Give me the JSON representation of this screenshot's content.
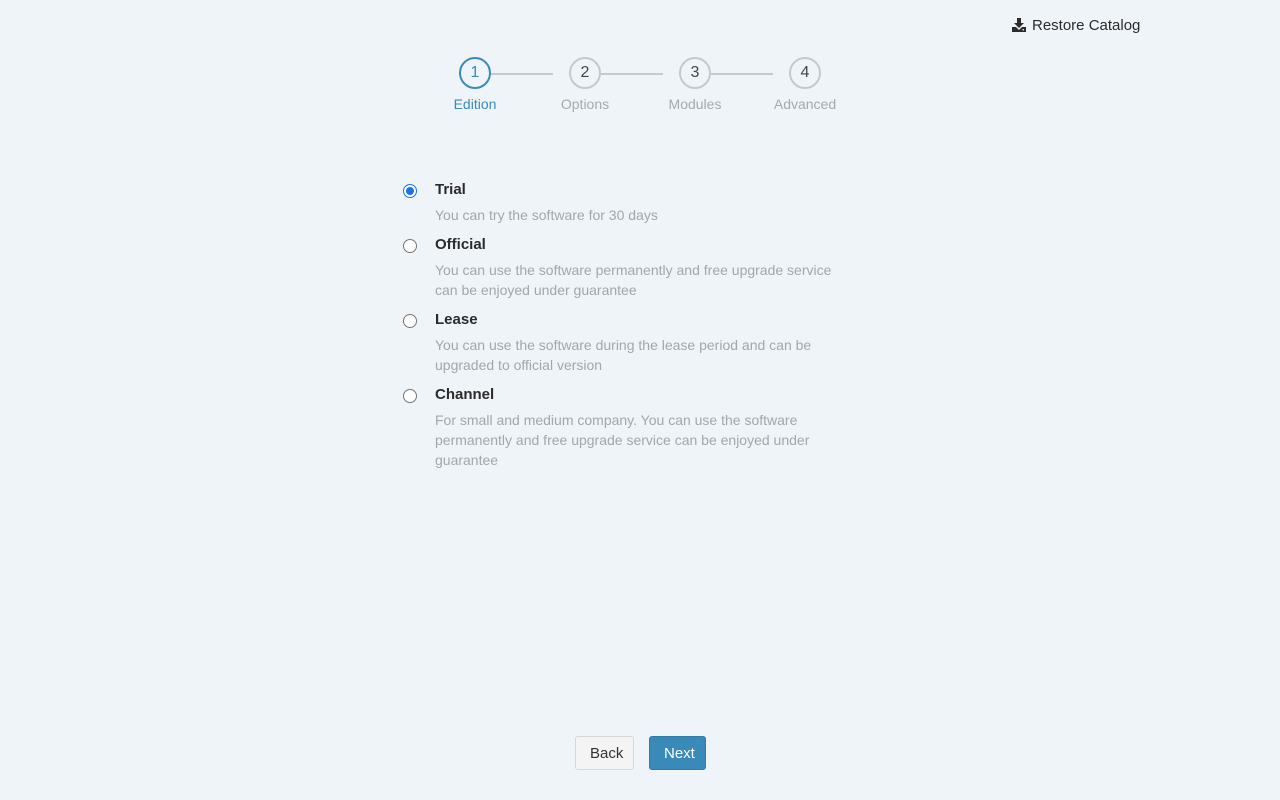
{
  "header": {
    "restore_label": "Restore Catalog",
    "restore_icon": "download-icon"
  },
  "stepper": {
    "steps": [
      {
        "number": "1",
        "label": "Edition",
        "active": true
      },
      {
        "number": "2",
        "label": "Options",
        "active": false
      },
      {
        "number": "3",
        "label": "Modules",
        "active": false
      },
      {
        "number": "4",
        "label": "Advanced",
        "active": false
      }
    ]
  },
  "options": [
    {
      "title": "Trial",
      "description": "You can try the software for 30 days",
      "selected": true
    },
    {
      "title": "Official",
      "description": "You can use the software permanently and free upgrade service can be enjoyed under guarantee",
      "selected": false
    },
    {
      "title": "Lease",
      "description": "You can use the software during the lease period and can be upgraded to official version",
      "selected": false
    },
    {
      "title": "Channel",
      "description": "For small and medium company. You can use the software permanently and free upgrade service can be enjoyed under guarantee",
      "selected": false
    }
  ],
  "footer": {
    "back_label": "Back",
    "next_label": "Next"
  },
  "colors": {
    "background": "#eff4f9",
    "accent": "#3a8ab9",
    "radio_selected": "#1a73e8",
    "muted_text": "#a3a7ab"
  }
}
